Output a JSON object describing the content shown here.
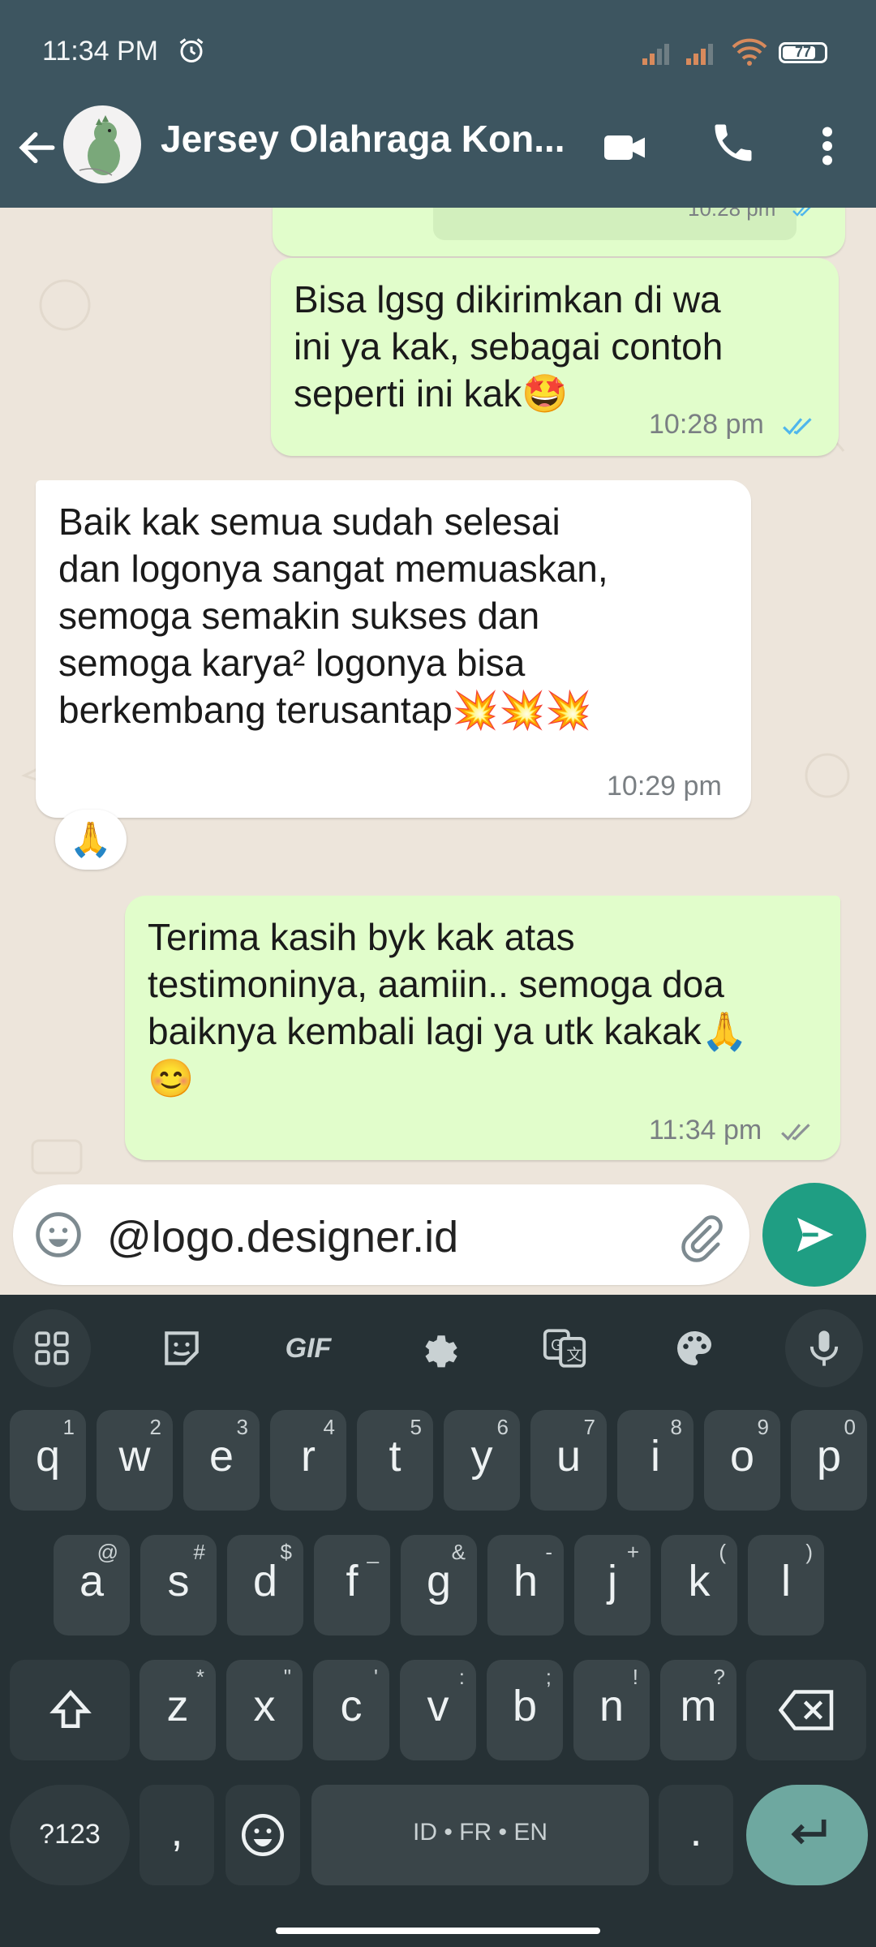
{
  "status_bar": {
    "time": "11:34 PM",
    "battery": "77"
  },
  "header": {
    "title": "Jersey Olahraga Kon..."
  },
  "messages": [
    {
      "direction": "outgoing",
      "text": "",
      "time": "10:28 pm",
      "status": "read"
    },
    {
      "direction": "outgoing",
      "text": "Bisa lgsg dikirimkan di wa\nini ya kak, sebagai contoh\nseperti ini kak🤩",
      "time": "10:28 pm",
      "status": "read"
    },
    {
      "direction": "incoming",
      "text": "Baik kak semua sudah selesai\ndan logonya sangat memuaskan,\nsemoga semakin sukses dan\nsemoga karya² logonya bisa\nberkembang terusantap💥💥💥",
      "time": "10:29 pm",
      "reaction": "🙏"
    },
    {
      "direction": "outgoing",
      "text": "Terima kasih byk kak atas\ntestimoninya, aamiin.. semoga doa\nbaiknya kembali lagi ya utk kakak🙏\n😊",
      "time": "11:34 pm",
      "status": "delivered"
    }
  ],
  "composer": {
    "text": "@logo.designer.id"
  },
  "keyboard": {
    "row1": [
      {
        "key": "q",
        "hint": "1"
      },
      {
        "key": "w",
        "hint": "2"
      },
      {
        "key": "e",
        "hint": "3"
      },
      {
        "key": "r",
        "hint": "4"
      },
      {
        "key": "t",
        "hint": "5"
      },
      {
        "key": "y",
        "hint": "6"
      },
      {
        "key": "u",
        "hint": "7"
      },
      {
        "key": "i",
        "hint": "8"
      },
      {
        "key": "o",
        "hint": "9"
      },
      {
        "key": "p",
        "hint": "0"
      }
    ],
    "row2": [
      {
        "key": "a",
        "hint": "@"
      },
      {
        "key": "s",
        "hint": "#"
      },
      {
        "key": "d",
        "hint": "$"
      },
      {
        "key": "f",
        "hint": "_"
      },
      {
        "key": "g",
        "hint": "&"
      },
      {
        "key": "h",
        "hint": "-"
      },
      {
        "key": "j",
        "hint": "+"
      },
      {
        "key": "k",
        "hint": "("
      },
      {
        "key": "l",
        "hint": ")"
      }
    ],
    "row3": [
      {
        "key": "z",
        "hint": "*"
      },
      {
        "key": "x",
        "hint": "\""
      },
      {
        "key": "c",
        "hint": "'"
      },
      {
        "key": "v",
        "hint": ":"
      },
      {
        "key": "b",
        "hint": ";"
      },
      {
        "key": "n",
        "hint": "!"
      },
      {
        "key": "m",
        "hint": "?"
      }
    ],
    "symbols_label": "?123",
    "comma": ",",
    "space_label": "ID • FR • EN",
    "period": ".",
    "toolbar_gif": "GIF"
  },
  "colors": {
    "header_bg": "#3d5560",
    "outgoing_bubble": "#e1fdcb",
    "incoming_bubble": "#ffffff",
    "read_ticks": "#4fb6ec",
    "send_button": "#1f9e83",
    "keyboard_bg": "#263135"
  }
}
